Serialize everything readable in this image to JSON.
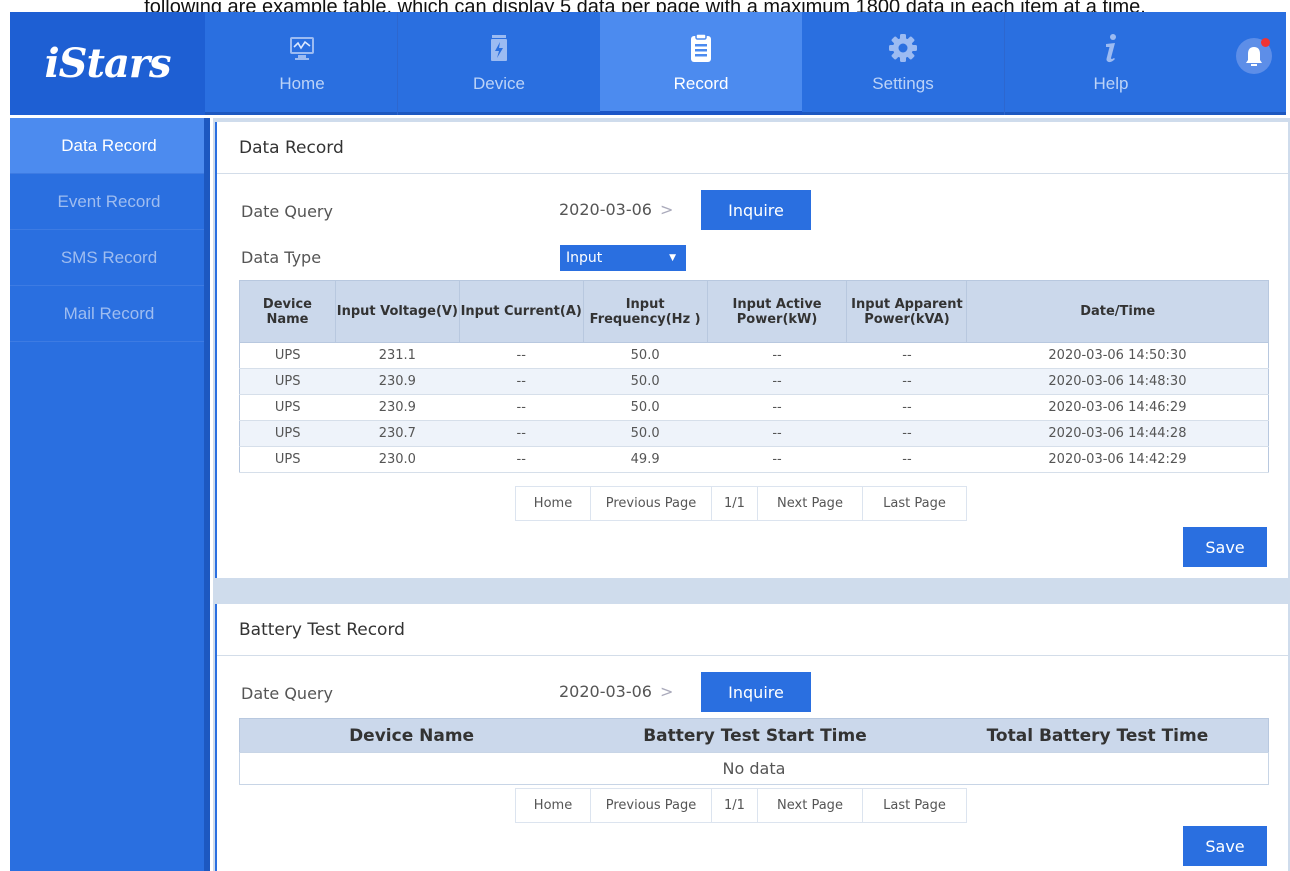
{
  "caption": "following are example table, which can display 5 data per page with a maximum 1800 data in each item at a time.",
  "logo": "iStars",
  "nav": [
    {
      "label": "Home",
      "icon": "monitor-icon"
    },
    {
      "label": "Device",
      "icon": "battery-icon"
    },
    {
      "label": "Record",
      "icon": "clipboard-icon"
    },
    {
      "label": "Settings",
      "icon": "gear-icon"
    },
    {
      "label": "Help",
      "icon": "info-icon"
    }
  ],
  "sidebar": [
    "Data Record",
    "Event Record",
    "SMS Record",
    "Mail Record"
  ],
  "data_record": {
    "title": "Data Record",
    "date_query_label": "Date Query",
    "date": "2020-03-06",
    "inquire": "Inquire",
    "data_type_label": "Data Type",
    "data_type_value": "Input",
    "headers": [
      "Device Name",
      "Input Voltage(V)",
      "Input Current(A)",
      "Input Frequency(Hz )",
      "Input Active Power(kW)",
      "Input Apparent Power(kVA)",
      "Date/Time"
    ],
    "rows": [
      [
        "UPS",
        "231.1",
        "--",
        "50.0",
        "--",
        "--",
        "2020-03-06 14:50:30"
      ],
      [
        "UPS",
        "230.9",
        "--",
        "50.0",
        "--",
        "--",
        "2020-03-06 14:48:30"
      ],
      [
        "UPS",
        "230.9",
        "--",
        "50.0",
        "--",
        "--",
        "2020-03-06 14:46:29"
      ],
      [
        "UPS",
        "230.7",
        "--",
        "50.0",
        "--",
        "--",
        "2020-03-06 14:44:28"
      ],
      [
        "UPS",
        "230.0",
        "--",
        "49.9",
        "--",
        "--",
        "2020-03-06 14:42:29"
      ]
    ],
    "pager": [
      "Home",
      "Previous Page",
      "1/1",
      "Next Page",
      "Last Page"
    ],
    "save": "Save"
  },
  "battery_record": {
    "title": "Battery Test Record",
    "date_query_label": "Date Query",
    "date": "2020-03-06",
    "inquire": "Inquire",
    "headers": [
      "Device Name",
      "Battery Test Start Time",
      "Total Battery Test Time"
    ],
    "empty": "No data",
    "pager": [
      "Home",
      "Previous Page",
      "1/1",
      "Next Page",
      "Last Page"
    ],
    "save": "Save"
  }
}
